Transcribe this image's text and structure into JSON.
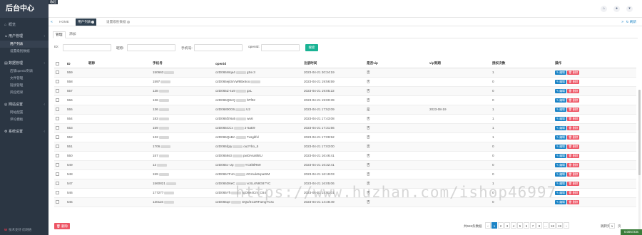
{
  "app": {
    "title": "后台中心"
  },
  "sidebar": {
    "overview": "概览",
    "groups": [
      {
        "label": "用户管理",
        "children": [
          {
            "label": "用户列表",
            "active": true
          },
          {
            "label": "设置级别数据"
          }
        ]
      },
      {
        "label": "数据管理",
        "children": [
          {
            "label": "店铺openid列表"
          },
          {
            "label": "文件管理"
          },
          {
            "label": "链接管理"
          },
          {
            "label": "风控结果"
          }
        ]
      },
      {
        "label": "网站设置",
        "children": [
          {
            "label": "网站配置"
          },
          {
            "label": "评论模板"
          }
        ]
      },
      {
        "label": "系统设置",
        "children": []
      }
    ],
    "footer_logo": "W",
    "footer_text": "技术支持 优网络"
  },
  "topbar": {
    "menu_toggle": "收起"
  },
  "tabs": {
    "home": "HOME",
    "active": "用户列表",
    "other": "设置级别数据"
  },
  "refresh_label": "刷新",
  "subtabs": {
    "first": "管理",
    "second": "添加"
  },
  "search": {
    "id_label": "ID:",
    "nickname_label": "昵称:",
    "phone_label": "手机号:",
    "openid_label": "openid:",
    "button": "搜索"
  },
  "table": {
    "headers": [
      "ID",
      "昵称",
      "手机号",
      "openid",
      "注册时间",
      "是否vip",
      "vip到期",
      "授权次数",
      "操作"
    ],
    "edit_label": "编辑",
    "delete_label": "删除",
    "rows": [
      {
        "id": "559",
        "phone": "150663",
        "openid": "ozD065Wqa4",
        "openid_tail": "gSe.3",
        "time": "2023-04-21 20:34:19",
        "vip": "否",
        "vip_expire": "",
        "count": "1"
      },
      {
        "id": "558",
        "phone": "1597",
        "openid": "ozD065eji3xVW8Bx6oo",
        "openid_tail": "",
        "time": "2023-04-21 19:56:59",
        "vip": "否",
        "vip_expire": "",
        "count": "0"
      },
      {
        "id": "557",
        "phone": "138",
        "openid": "ozD065Z-4u9",
        "openid_tail": "gxL",
        "time": "2023-04-21 19:05:22",
        "vip": "否",
        "vip_expire": "",
        "count": "0"
      },
      {
        "id": "556",
        "phone": "136",
        "openid": "ozD065Q8cQ",
        "openid_tail": "hPf02",
        "time": "2023-04-21 19:00:39",
        "vip": "否",
        "vip_expire": "",
        "count": "0"
      },
      {
        "id": "555",
        "phone": "136",
        "openid": "ozD06800G6",
        "openid_tail": "U2",
        "time": "2023-04-21 17:52:09",
        "vip": "是",
        "vip_expire": "2023-08-19",
        "count": "1"
      },
      {
        "id": "554",
        "phone": "183",
        "openid": "ozD065f2Nu5",
        "openid_tail": "wu6",
        "time": "2023-04-21 17:43:08",
        "vip": "否",
        "vip_expire": "",
        "count": "1"
      },
      {
        "id": "553",
        "phone": "159",
        "openid": "ozD065CCx",
        "openid_tail": "2-5aE9",
        "time": "2023-04-21 17:31:56",
        "vip": "否",
        "vip_expire": "",
        "count": "1"
      },
      {
        "id": "552",
        "phone": "132",
        "openid": "ozD065QxBA",
        "openid_tail": "Txsgkfxl",
        "time": "2023-04-21 17:09:52",
        "vip": "否",
        "vip_expire": "",
        "count": "1"
      },
      {
        "id": "551",
        "phone": "1706",
        "openid": "ozD065fgIy",
        "openid_tail": "ou2Ybo_5",
        "time": "2023-04-21 17:03:00",
        "vip": "否",
        "vip_expire": "",
        "count": "0"
      },
      {
        "id": "550",
        "phone": "157",
        "openid": "ozD065ks3",
        "openid_tail": "pwDAsa9btU",
        "time": "2023-04-21 16:46:41",
        "vip": "否",
        "vip_expire": "",
        "count": "0"
      },
      {
        "id": "549",
        "phone": "13",
        "openid": "ozD065c-Up",
        "openid_tail": "YC8l8lR69",
        "time": "2023-04-21 16:32:41",
        "vip": "否",
        "vip_expire": "",
        "count": "0"
      },
      {
        "id": "548",
        "phone": "159",
        "openid": "ozD065YF4A",
        "openid_tail": "rtGmuk8vpa0rM",
        "time": "2023-04-21 16:19:03",
        "vip": "否",
        "vip_expire": "",
        "count": "0"
      },
      {
        "id": "547",
        "phone": "1560821",
        "openid": "ozD065D6eC",
        "openid_tail": "vcSL4N8G87YC",
        "time": "2023-04-21 16:05:06",
        "vip": "否",
        "vip_expire": "",
        "count": "1"
      },
      {
        "id": "546",
        "phone": "177277",
        "openid": "ozD065Yh",
        "openid_tail": "rgO6e4Cm_C64",
        "time": "2023-04-21 14:51:01",
        "vip": "否",
        "vip_expire": "",
        "count": "0"
      },
      {
        "id": "545",
        "phone": "130116",
        "openid": "ozD065qe",
        "openid_tail": "OQ2/4C3RFamgTCsc",
        "time": "2023-04-21 14:48:49",
        "vip": "否",
        "vip_expire": "",
        "count": "0"
      }
    ]
  },
  "bottom": {
    "batch_delete": "删除",
    "pager_info": "共559条数据",
    "prev": "‹",
    "pages": [
      "1",
      "2",
      "3",
      "4",
      "5",
      "6",
      "7",
      "8",
      "...",
      "18",
      "19"
    ],
    "next": "›",
    "jump_label": "跳转到",
    "jump_value": "1",
    "jump_unit": "页"
  },
  "watermark": "https://www.huzhan.com/ishop46997",
  "corner_badge": "0.005723s",
  "colors": {
    "sidebar_bg": "#2b3643",
    "primary": "#1c84c6",
    "success": "#1ab394",
    "danger": "#ed5565"
  }
}
